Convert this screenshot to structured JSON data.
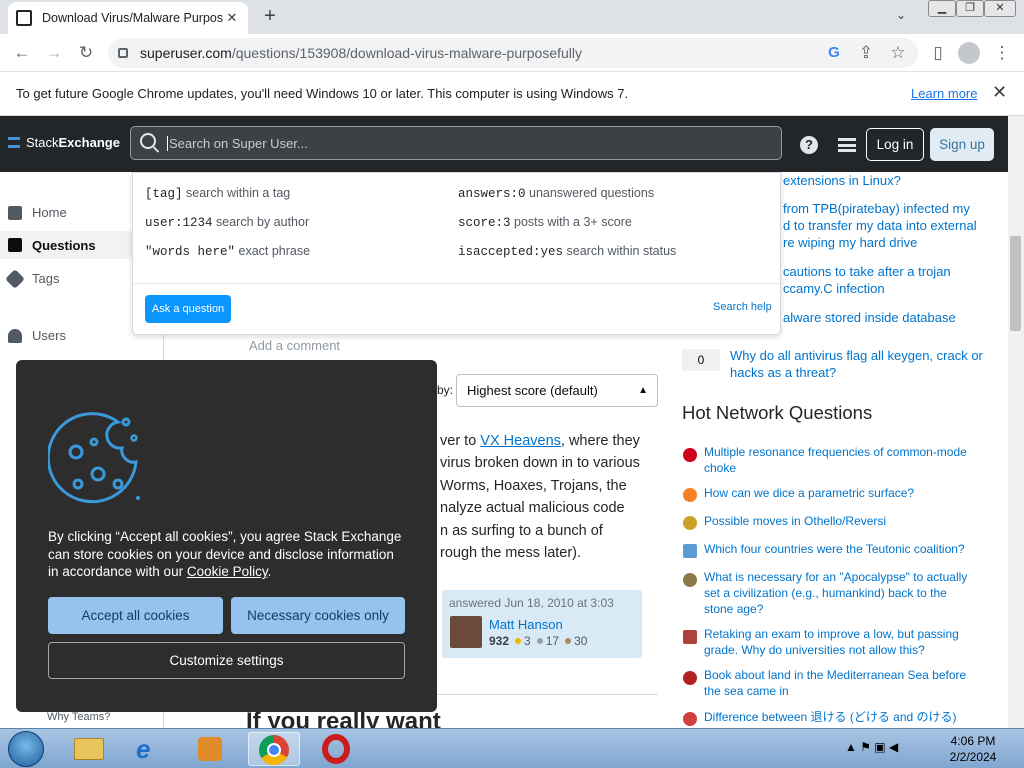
{
  "browser": {
    "tab_title": "Download Virus/Malware Purpos",
    "new_tab": "+",
    "tab_close": "✕",
    "tab_search": "⌄",
    "url_host": "superuser.com",
    "url_path": "/questions/153908/download-virus-malware-purposefully",
    "infobar_text": "To get future Google Chrome updates, you'll need Windows 10 or later. This computer is using Windows 7.",
    "infobar_link": "Learn more",
    "infobar_close": "✕"
  },
  "topbar": {
    "logo_a": "Stack",
    "logo_b": "Exchange",
    "search_placeholder": "Search on Super User...",
    "help": "?",
    "login": "Log in",
    "signup": "Sign up"
  },
  "leftnav": {
    "home": "Home",
    "questions": "Questions",
    "tags": "Tags",
    "users": "Users",
    "why_teams": "Why Teams?"
  },
  "dropdown": {
    "hints": [
      {
        "code": "[tag]",
        "text": "search within a tag"
      },
      {
        "code": "user:1234",
        "text": "search by author"
      },
      {
        "code": "\"words here\"",
        "text": "exact phrase"
      },
      {
        "code": "answers:0",
        "text": "unanswered questions"
      },
      {
        "code": "score:3",
        "text": "posts with a 3+ score"
      },
      {
        "code": "isaccepted:yes",
        "text": "search within status"
      }
    ],
    "ask": "Ask a question",
    "help": "Search help"
  },
  "main": {
    "add_comment": "Add a comment",
    "sort_label": "by:",
    "sort_value": "Highest score (default)",
    "answer_lines": [
      "ver to ",
      "virus broken down in to various",
      "Worms, Hoaxes, Trojans, the",
      "nalyze actual malicious code",
      "n as surfing to a bunch of",
      "rough the mess later)."
    ],
    "answer_link": "VX Heavens",
    "answer_after_link": ", where they",
    "answered": "answered Jun 18, 2010 at 3:03",
    "user_name": "Matt Hanson",
    "rep": "932",
    "gold": "3",
    "silver": "17",
    "bronze": "30",
    "next_heading": "If you really want"
  },
  "sidebar": {
    "linked": [
      "extensions in Linux?",
      "from TPB(piratebay) infected my\nd to transfer my data into external\nre wiping my hard drive",
      "cautions to take after a trojan\nccamy.C infection",
      "alware stored inside database"
    ],
    "vote": "0",
    "linked_last": "Why do all antivirus flag all keygen, crack or hacks as a threat?",
    "hnq_title": "Hot Network Questions",
    "hnq": [
      "Multiple resonance frequencies of common-mode choke",
      "How can we dice a parametric surface?",
      "Possible moves in Othello/Reversi",
      "Which four countries were the Teutonic coalition?",
      "What is necessary for an \"Apocalypse\" to actually set a civilization (e.g., humankind) back to the stone age?",
      "Retaking an exam to improve a low, but passing grade. Why do universities not allow this?",
      "Book about land in the Mediterranean Sea before the sea came in",
      "Difference between 退ける (どける and のける)"
    ],
    "hnq_colors": [
      "#d0021b",
      "#f48024",
      "#c9a227",
      "#5b9bd5",
      "#8a7a4a",
      "#b0403a",
      "#b22222",
      "#d04040"
    ]
  },
  "cookie": {
    "text_a": "By clicking “Accept all cookies”, you agree Stack Exchange can store cookies on your device and disclose information in accordance with our ",
    "link": "Cookie Policy",
    "text_b": ".",
    "accept": "Accept all cookies",
    "necessary": "Necessary cookies only",
    "customize": "Customize settings"
  },
  "taskbar": {
    "time": "4:06 PM",
    "date": "2/2/2024"
  }
}
